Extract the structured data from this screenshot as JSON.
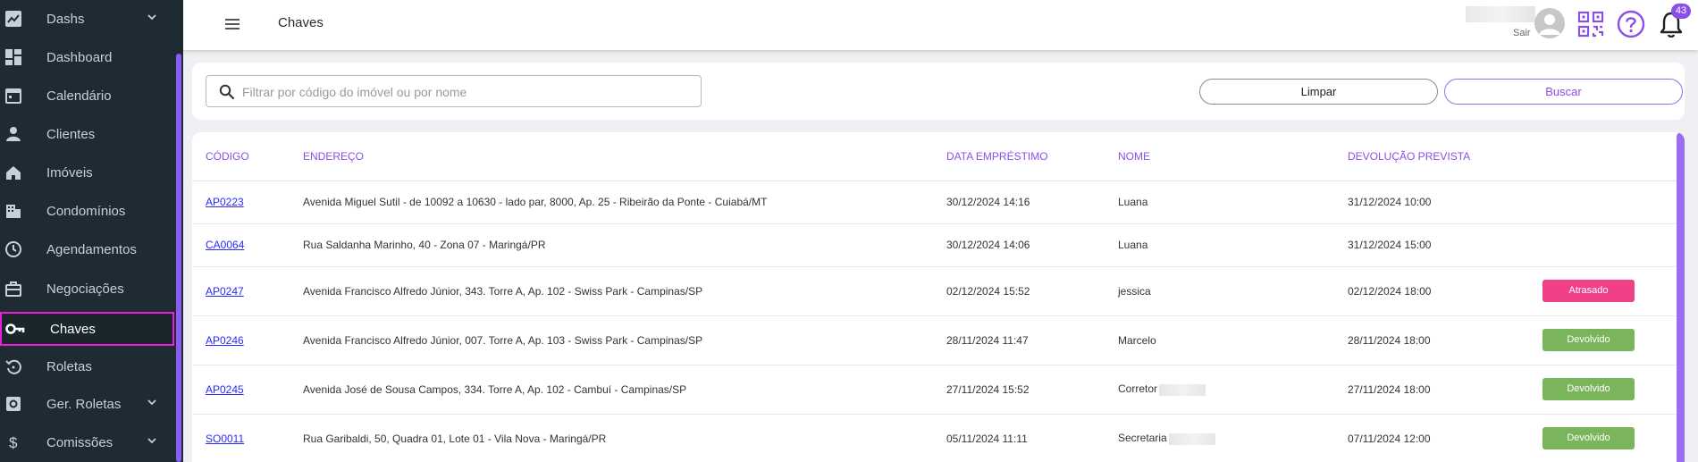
{
  "sidebar": {
    "items": [
      {
        "label": "Dashs",
        "icon": "trending-up-icon",
        "has_chevron": true
      },
      {
        "label": "Dashboard",
        "icon": "dashboard-icon",
        "has_chevron": false
      },
      {
        "label": "Calendário",
        "icon": "calendar-icon",
        "has_chevron": false
      },
      {
        "label": "Clientes",
        "icon": "person-icon",
        "has_chevron": false
      },
      {
        "label": "Imóveis",
        "icon": "house-icon",
        "has_chevron": false
      },
      {
        "label": "Condomínios",
        "icon": "building-icon",
        "has_chevron": false
      },
      {
        "label": "Agendamentos",
        "icon": "clock-icon",
        "has_chevron": false
      },
      {
        "label": "Negociações",
        "icon": "briefcase-icon",
        "has_chevron": false
      },
      {
        "label": "Chaves",
        "icon": "key-icon",
        "has_chevron": false,
        "active": true
      },
      {
        "label": "Roletas",
        "icon": "rotate-icon",
        "has_chevron": false
      },
      {
        "label": "Ger. Roletas",
        "icon": "settings-box-icon",
        "has_chevron": true
      },
      {
        "label": "Comissões",
        "icon": "dollar-icon",
        "has_chevron": true
      }
    ]
  },
  "header": {
    "title": "Chaves",
    "logout_label": "Sair",
    "notification_count": "43"
  },
  "filter": {
    "search_placeholder": "Filtrar por código do imóvel ou por nome",
    "search_value": "",
    "clear_label": "Limpar",
    "search_label": "Buscar"
  },
  "table": {
    "columns": [
      "CÓDIGO",
      "ENDEREÇO",
      "DATA EMPRÉSTIMO",
      "NOME",
      "DEVOLUÇÃO PREVISTA"
    ],
    "rows": [
      {
        "code": "AP0223",
        "address": "Avenida Miguel Sutil - de 10092 a 10630 - lado par, 8000, Ap. 25 - Ribeirão da Ponte - Cuiabá/MT",
        "loan_date": "30/12/2024 14:16",
        "name": "Luana",
        "name_redacted": false,
        "return_date": "31/12/2024 10:00",
        "status": ""
      },
      {
        "code": "CA0064",
        "address": "Rua Saldanha Marinho, 40 - Zona 07 - Maringá/PR",
        "loan_date": "30/12/2024 14:06",
        "name": "Luana",
        "name_redacted": false,
        "return_date": "31/12/2024 15:00",
        "status": ""
      },
      {
        "code": "AP0247",
        "address": "Avenida Francisco Alfredo Júnior, 343. Torre A, Ap. 102 - Swiss Park - Campinas/SP",
        "loan_date": "02/12/2024 15:52",
        "name": "jessica",
        "name_redacted": false,
        "return_date": "02/12/2024 18:00",
        "status": "Atrasado"
      },
      {
        "code": "AP0246",
        "address": "Avenida Francisco Alfredo Júnior, 007. Torre A, Ap. 103 - Swiss Park - Campinas/SP",
        "loan_date": "28/11/2024 11:47",
        "name": "Marcelo",
        "name_redacted": false,
        "return_date": "28/11/2024 18:00",
        "status": "Devolvido"
      },
      {
        "code": "AP0245",
        "address": "Avenida José de Sousa Campos, 334. Torre A, Ap. 102 - Cambuí - Campinas/SP",
        "loan_date": "27/11/2024 15:52",
        "name": "Corretor",
        "name_redacted": true,
        "return_date": "27/11/2024 18:00",
        "status": "Devolvido"
      },
      {
        "code": "SO0011",
        "address": "Rua Garibaldi, 50, Quadra 01, Lote 01 - Vila Nova - Maringá/PR",
        "loan_date": "05/11/2024 11:11",
        "name": "Secretaria",
        "name_redacted": true,
        "return_date": "07/11/2024 12:00",
        "status": "Devolvido"
      }
    ]
  },
  "colors": {
    "sidebar_bg": "#1f2b33",
    "accent": "#8a4fe8",
    "active_outline": "#e91ee0",
    "status_late": "#f0408a",
    "status_returned": "#7ab55c",
    "link": "#2a2aff"
  }
}
